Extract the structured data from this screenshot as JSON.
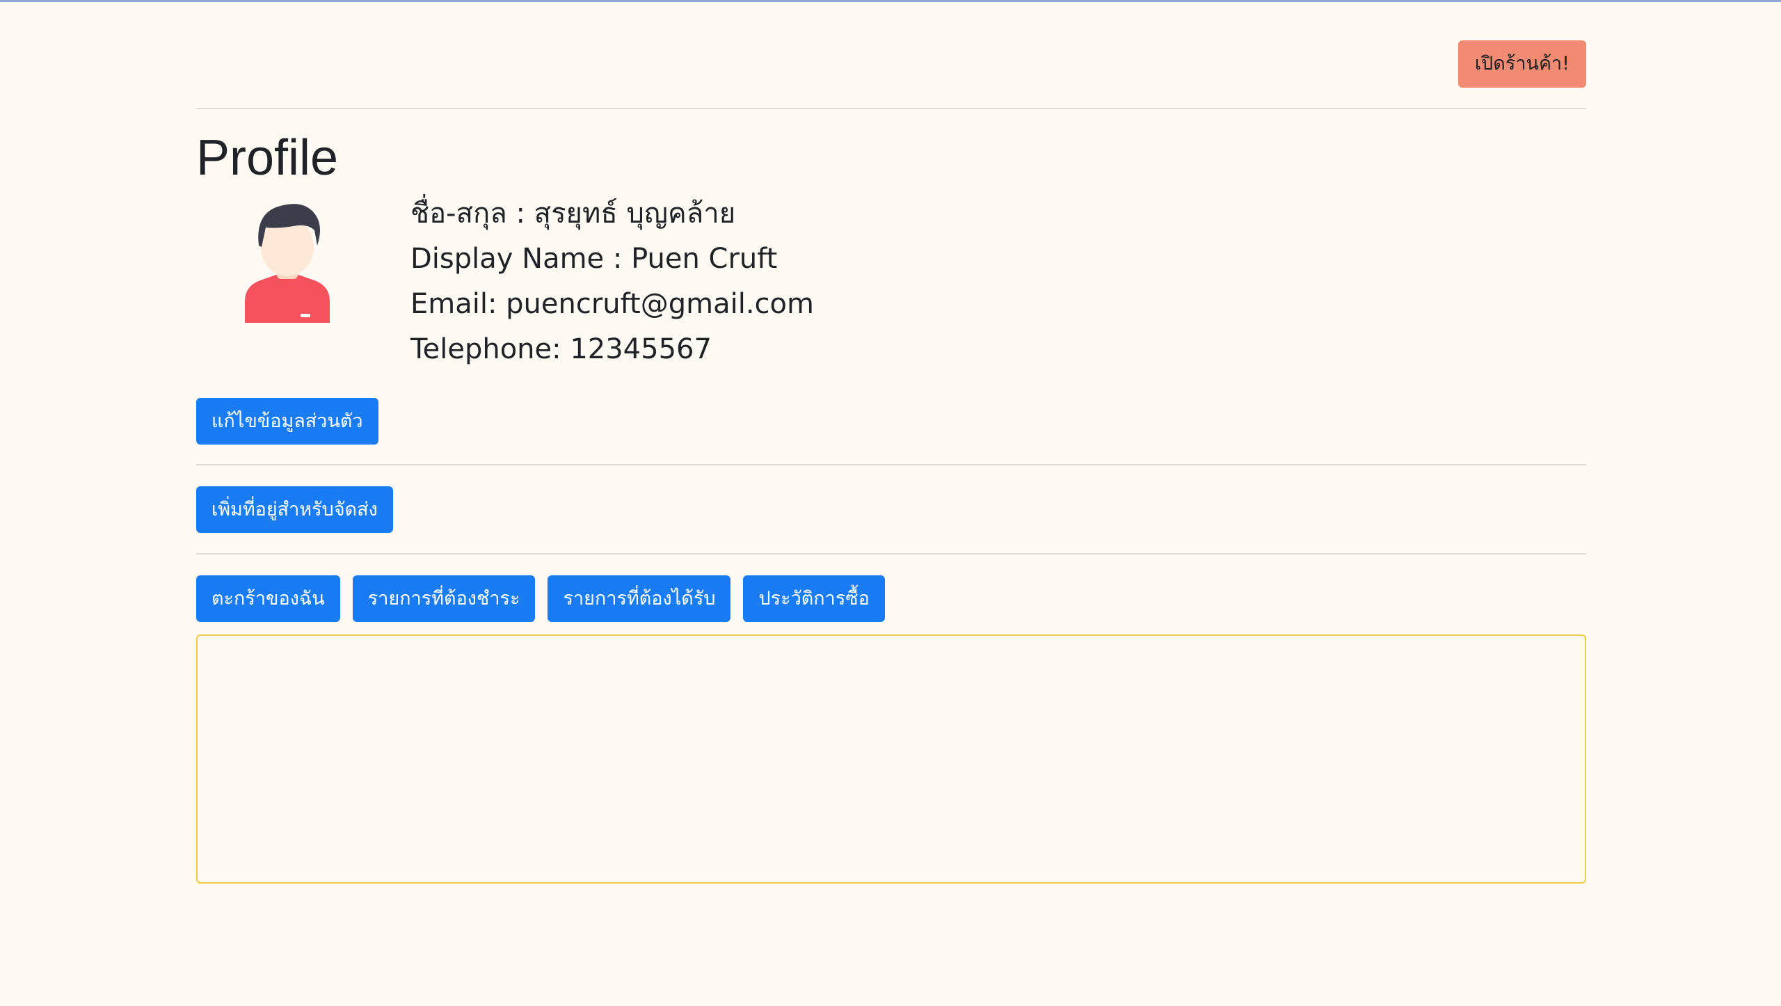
{
  "header": {
    "open_shop_label": "เปิดร้านค้า!"
  },
  "page": {
    "title": "Profile"
  },
  "profile": {
    "fullname_line": "ชื่อ-สกุล : สุรยุทธ์ บุญคล้าย",
    "display_name_line": "Display Name : Puen Cruft",
    "email_line": "Email: puencruft@gmail.com",
    "telephone_line": "Telephone: 12345567",
    "avatar_icon": "user-avatar-icon"
  },
  "actions": {
    "edit_profile_label": "แก้ไขข้อมูลส่วนตัว",
    "add_address_label": "เพิ่มที่อยู่สำหรับจัดส่ง"
  },
  "tabs": [
    {
      "label": "ตะกร้าของฉัน"
    },
    {
      "label": "รายการที่ต้องชำระ"
    },
    {
      "label": "รายการที่ต้องได้รับ"
    },
    {
      "label": "ประวัติการซื้อ"
    }
  ],
  "colors": {
    "background": "#fffaf4",
    "primary": "#1a7cf5",
    "shop_button": "#f28b73",
    "content_border": "#f2c84b"
  }
}
